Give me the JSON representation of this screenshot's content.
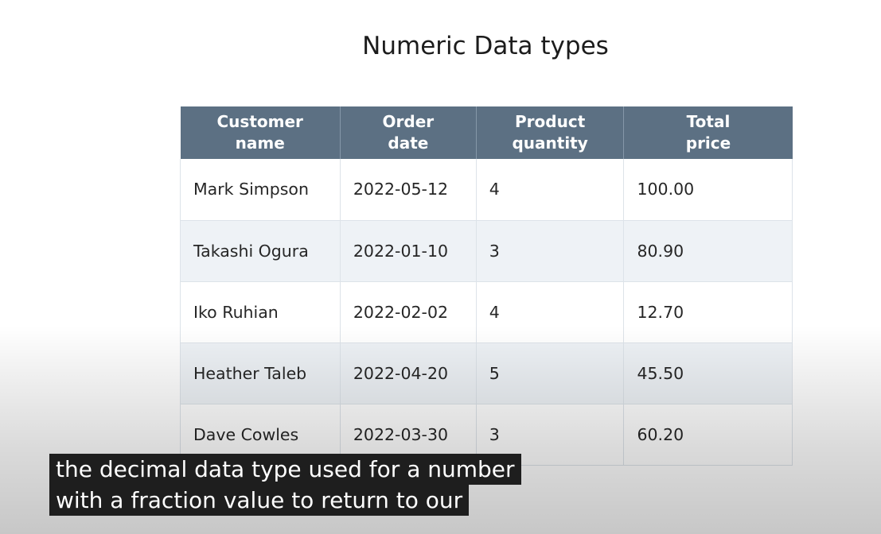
{
  "slide": {
    "title": "Numeric Data types"
  },
  "table": {
    "headers": [
      [
        "Customer",
        "name"
      ],
      [
        "Order",
        "date"
      ],
      [
        "Product",
        "quantity"
      ],
      [
        "Total",
        "price"
      ]
    ],
    "rows": [
      [
        "Mark Simpson",
        "2022-05-12",
        "4",
        "100.00"
      ],
      [
        "Takashi Ogura",
        "2022-01-10",
        "3",
        "80.90"
      ],
      [
        "Iko Ruhian",
        "2022-02-02",
        "4",
        "12.70"
      ],
      [
        "Heather Taleb",
        "2022-04-20",
        "5",
        "45.50"
      ],
      [
        "Dave Cowles",
        "2022-03-30",
        "3",
        "60.20"
      ]
    ]
  },
  "caption": {
    "lines": [
      "the decimal data type used for a number",
      "with a fraction value to return to our"
    ]
  },
  "colors": {
    "header_bg": "#5c7083",
    "row_alt_bg": "#eef2f6",
    "caption_bg": "#1e1e1e"
  }
}
